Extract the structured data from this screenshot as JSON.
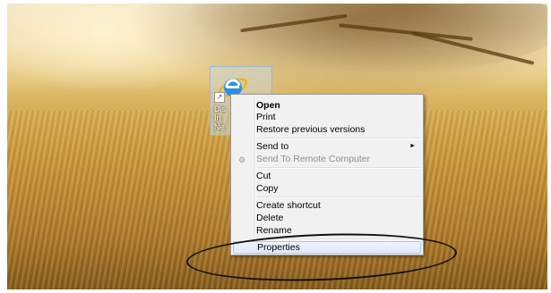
{
  "desktop": {
    "icon": {
      "name": "internet-explorer-shortcut",
      "label_lines": [
        "Dis",
        "In",
        "Ne"
      ]
    }
  },
  "context_menu": {
    "items": [
      {
        "label": "Open",
        "style": "bold"
      },
      {
        "label": "Print"
      },
      {
        "label": "Restore previous versions"
      },
      {
        "label": "Send to",
        "submenu": "►"
      },
      {
        "label": "Send To Remote Computer",
        "style": "disabled"
      },
      {
        "label": "Cut"
      },
      {
        "label": "Copy"
      },
      {
        "label": "Create shortcut"
      },
      {
        "label": "Delete"
      },
      {
        "label": "Rename"
      },
      {
        "label": "Properties",
        "style": "selected"
      }
    ]
  },
  "colors": {
    "menu_bg": "#f1f1f1",
    "highlight": "#dceaf9",
    "disabled_text": "#8d8d8d",
    "field": "#c8953a"
  }
}
